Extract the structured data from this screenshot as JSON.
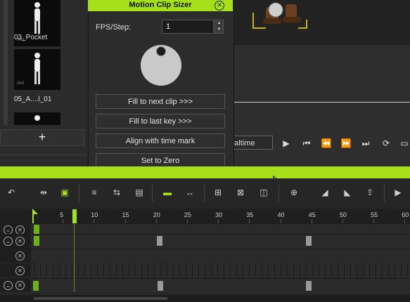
{
  "library": {
    "items": [
      {
        "label": "03_Pocket",
        "tag": "iAni"
      },
      {
        "label": "05_A....l_01",
        "tag": "iAni"
      }
    ],
    "add_label": "+"
  },
  "dialog": {
    "title": "Motion Clip Sizer",
    "close_icon": "close-icon",
    "fps_label": "FPS/Step:",
    "fps_value": "1",
    "buttons": [
      {
        "label": "Fill to next clip >>>"
      },
      {
        "label": "Fill to last key >>>"
      },
      {
        "label": "Align with time mark"
      },
      {
        "label": "Set to Zero"
      }
    ]
  },
  "playback": {
    "mode_label": "ealtime",
    "controls": [
      "play-icon",
      "first-frame-icon",
      "rewind-icon",
      "fast-forward-icon",
      "last-frame-icon",
      "loop-icon",
      "chat-icon"
    ]
  },
  "timeline": {
    "ruler": [
      "5",
      "10",
      "15",
      "20",
      "25",
      "30",
      "35",
      "40",
      "45",
      "50",
      "55",
      "60"
    ],
    "toolbar_icons": [
      "undo-icon",
      "align-icon",
      "clip-range-icon",
      "key-list-icon",
      "transition-icon",
      "save-icon",
      "insert-icon",
      "stretch-icon",
      "add-track-icon",
      "delete-track-icon",
      "split-icon",
      "zoom-icon",
      "collapse-left-icon",
      "collapse-right-icon",
      "export-icon",
      "play-icon"
    ]
  },
  "colors": {
    "accent": "#a5e01a",
    "panel": "#2c2c2c",
    "background": "#262626"
  }
}
